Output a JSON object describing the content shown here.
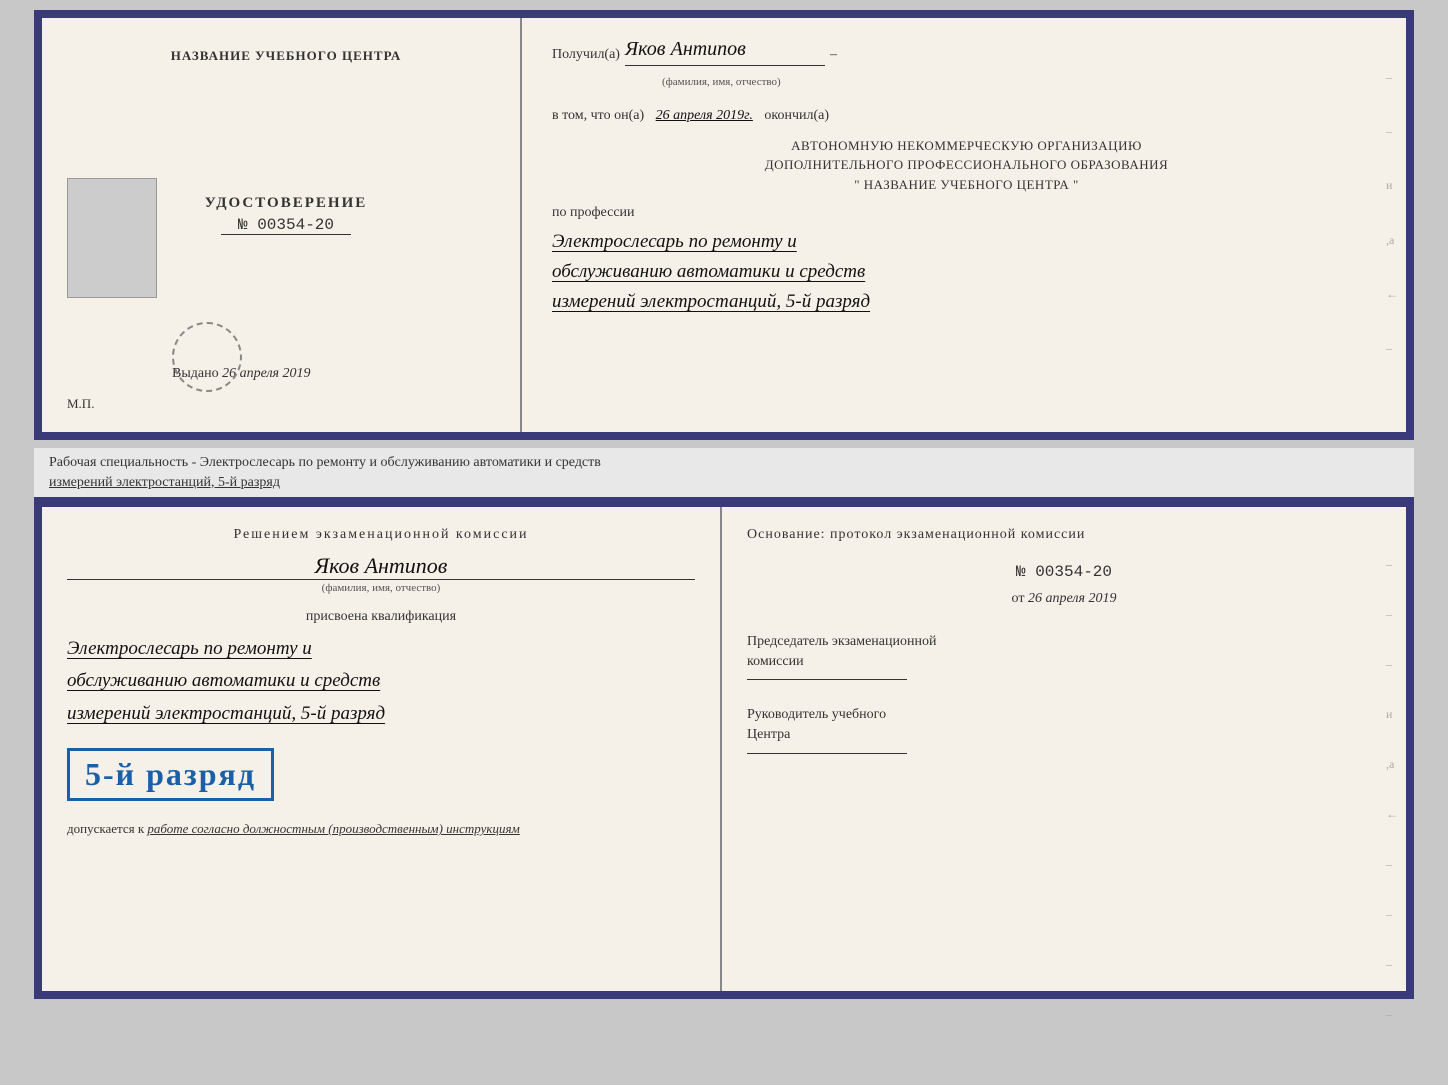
{
  "topDoc": {
    "left": {
      "trainingCenterLabel": "НАЗВАНИЕ УЧЕБНОГО ЦЕНТРА",
      "udostTitle": "УДОСТОВЕРЕНИЕ",
      "udostNumber": "№ 00354-20",
      "vydanoLabel": "Выдано",
      "vydanoDate": "26 апреля 2019",
      "mpLabel": "М.П."
    },
    "right": {
      "poluchilLabel": "Получил(а)",
      "recipientName": "Яков Антипов",
      "fioSubtitle": "(фамилия, имя, отчество)",
      "vtomLabel": "в том, что он(а)",
      "vtomDate": "26 апреля 2019г.",
      "okonchilLabel": "окончил(а)",
      "orgLine1": "АВТОНОМНУЮ НЕКОММЕРЧЕСКУЮ ОРГАНИЗАЦИЮ",
      "orgLine2": "ДОПОЛНИТЕЛЬНОГО ПРОФЕССИОНАЛЬНОГО ОБРАЗОВАНИЯ",
      "orgLine3": "\"   НАЗВАНИЕ УЧЕБНОГО ЦЕНТРА   \"",
      "poProfessiiLabel": "по профессии",
      "professionLine1": "Электрослесарь по ремонту и",
      "professionLine2": "обслуживанию автоматики и средств",
      "professionLine3": "измерений электростанций, 5-й разряд"
    }
  },
  "workingSpecialty": {
    "label": "Рабочая специальность - Электрослесарь по ремонту и обслуживанию автоматики и средств",
    "label2": "измерений электростанций, 5-й разряд"
  },
  "bottomDoc": {
    "left": {
      "resheniyemText": "Решением  экзаменационной  комиссии",
      "recipientName": "Яков Антипов",
      "fioSubtitle": "(фамилия, имя, отчество)",
      "prisvoyenaText": "присвоена квалификация",
      "qualLine1": "Электрослесарь по ремонту и",
      "qualLine2": "обслуживанию автоматики и средств",
      "qualLine3": "измерений электростанций, 5-й разряд",
      "razryadBadge": "5-й разряд",
      "dopuskaetsyaLabel": "допускается к",
      "dopuskaetsyaText": "работе согласно должностным (производственным) инструкциям"
    },
    "right": {
      "osnovanieLabelLine1": "Основание:  протокол  экзаменационной  комиссии",
      "protocolNumber": "№  00354-20",
      "otLabel": "от",
      "otDate": "26 апреля 2019",
      "predsedatelLine1": "Председатель экзаменационной",
      "predsedatelLine2": "комиссии",
      "rukovoditelLine1": "Руководитель учебного",
      "rukovoditelLine2": "Центра"
    }
  }
}
